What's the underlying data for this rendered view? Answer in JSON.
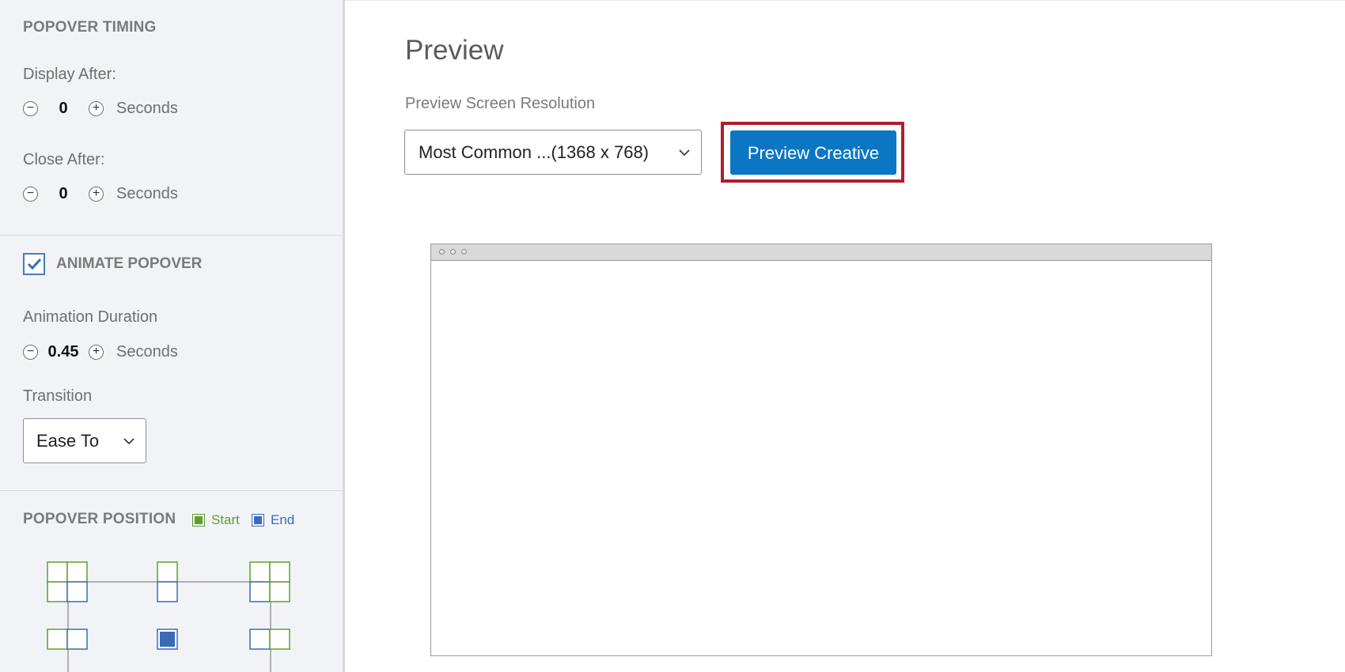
{
  "sidebar": {
    "timing": {
      "title": "POPOVER TIMING",
      "display_after": {
        "label": "Display After:",
        "value": "0",
        "unit": "Seconds"
      },
      "close_after": {
        "label": "Close After:",
        "value": "0",
        "unit": "Seconds"
      }
    },
    "animate": {
      "label": "ANIMATE POPOVER",
      "checked": true,
      "duration": {
        "label": "Animation Duration",
        "value": "0.45",
        "unit": "Seconds"
      },
      "transition": {
        "label": "Transition",
        "selected": "Ease To"
      }
    },
    "position": {
      "title": "POPOVER POSITION",
      "legend": {
        "start": "Start",
        "end": "End"
      },
      "selected": "center"
    },
    "stepper_icons": {
      "minus": "minus-circle-icon",
      "plus": "plus-circle-icon"
    }
  },
  "main": {
    "title": "Preview",
    "resolution_label": "Preview Screen Resolution",
    "resolution_selected": "Most Common ...(1368 x 768)",
    "preview_button": "Preview Creative"
  },
  "colors": {
    "primary": "#0b77c4",
    "highlight": "#b11d2e",
    "start_green": "#5ea02a",
    "end_blue": "#3a6cb5",
    "sidebar_bg": "#f1f3f7"
  }
}
